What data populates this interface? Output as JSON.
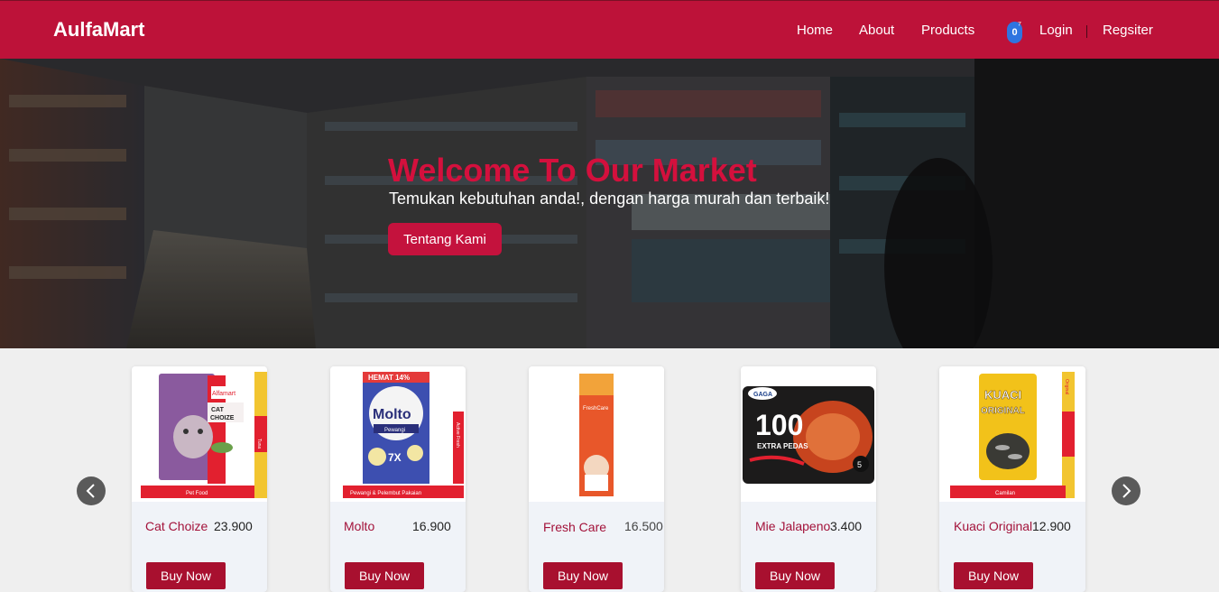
{
  "header": {
    "brand": "AulfaMart",
    "nav": {
      "home": "Home",
      "about": "About",
      "products": "Products",
      "login": "Login",
      "register": "Regsiter"
    },
    "cart_count": "0"
  },
  "hero": {
    "title": "Welcome To Our Market",
    "subtitle": "Temukan kebutuhan anda!, dengan harga murah dan terbaik!",
    "button": "Tentang Kami"
  },
  "products": [
    {
      "name": "Cat Choize",
      "price": "23.900",
      "buy": "Buy Now",
      "packshot_text": [
        "Alfamart",
        "CAT",
        "CHOIZE",
        "Pet Food",
        "Tuna"
      ]
    },
    {
      "name": "Molto",
      "price": "16.900",
      "buy": "Buy Now",
      "packshot_text": [
        "HEMAT 14%",
        "Molto",
        "Pewangi",
        "7X",
        "Pewangi & Pelembut Pakaian",
        "Active Fresh"
      ]
    },
    {
      "name": "Fresh Care",
      "price": "16.500",
      "buy": "Buy Now",
      "packshot_text": [
        "FreshCare"
      ]
    },
    {
      "name": "Mie Jalapeno",
      "price": "3.400",
      "buy": "Buy Now",
      "packshot_text": [
        "GAGA",
        "100",
        "EXTRA PEDAS",
        "5"
      ]
    },
    {
      "name": "Kuaci Original",
      "price": "12.900",
      "buy": "Buy Now",
      "packshot_text": [
        "KUACI",
        "ORIGINAL",
        "Camilan",
        "Original"
      ]
    }
  ],
  "colors": {
    "brand": "#bd1239",
    "accent": "#d4103d",
    "button": "#a8102f",
    "badge": "#2f74e0"
  },
  "icons": {
    "prev": "chevron-left-icon",
    "next": "chevron-right-icon"
  }
}
